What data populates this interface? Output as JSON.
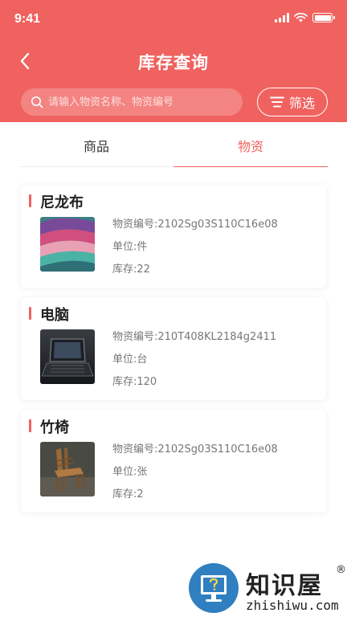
{
  "status_bar": {
    "time": "9:41"
  },
  "header": {
    "title": "库存查询",
    "search_placeholder": "请输入物资名称、物资编号",
    "filter_label": "筛选"
  },
  "tabs": [
    {
      "label": "商品",
      "active": false
    },
    {
      "label": "物资",
      "active": true
    }
  ],
  "items": [
    {
      "name": "尼龙布",
      "code": "物资编号:2102Sg03S110C16e08",
      "unit": "单位:件",
      "stock": "库存:22",
      "image": "fabric-image"
    },
    {
      "name": "电脑",
      "code": "物资编号:210T408KL2184g2411",
      "unit": "单位:台",
      "stock": "库存:120",
      "image": "laptop-image"
    },
    {
      "name": "竹椅",
      "code": "物资编号:2102Sg03S110C16e08",
      "unit": "单位:张",
      "stock": "库存:2",
      "image": "chair-image"
    }
  ],
  "watermark": {
    "cn": "知识屋",
    "reg": "®",
    "en": "zhishiwu.com"
  },
  "colors": {
    "accent": "#f0625f",
    "text": "#333333",
    "muted": "#777777"
  }
}
